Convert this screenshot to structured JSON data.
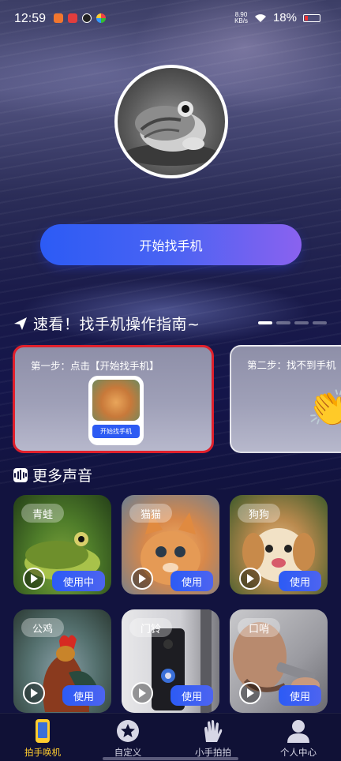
{
  "status_bar": {
    "time": "12:59",
    "net_speed_value": "8.90",
    "net_speed_unit": "KB/s",
    "battery": "18%"
  },
  "hero": {
    "start_button_label": "开始找手机"
  },
  "guide": {
    "title": "速看！找手机操作指南~",
    "cards": [
      {
        "step": "第一步：点击【开始找手机】",
        "mini_button": "开始找手机"
      },
      {
        "step": "第二步：找不到手机"
      }
    ]
  },
  "more_sounds": {
    "title": "更多声音",
    "items": [
      {
        "name": "青蛙",
        "action": "使用中"
      },
      {
        "name": "猫猫",
        "action": "使用"
      },
      {
        "name": "狗狗",
        "action": "使用"
      },
      {
        "name": "公鸡",
        "action": "使用"
      },
      {
        "name": "门铃",
        "action": "使用"
      },
      {
        "name": "口哨",
        "action": "使用"
      }
    ]
  },
  "tabbar": {
    "items": [
      {
        "label": "拍手唤机",
        "icon": "phone-icon",
        "active": true
      },
      {
        "label": "自定义",
        "icon": "star-icon",
        "active": false
      },
      {
        "label": "小手拍拍",
        "icon": "clap-icon",
        "active": false
      },
      {
        "label": "个人中心",
        "icon": "person-icon",
        "active": false
      }
    ]
  },
  "colors": {
    "accent_blue": "#2c5bf5",
    "accent_purple": "#8a62ef",
    "active_tab": "#ffcc2e",
    "highlight_border": "#e0202c",
    "background": "#12133f"
  }
}
